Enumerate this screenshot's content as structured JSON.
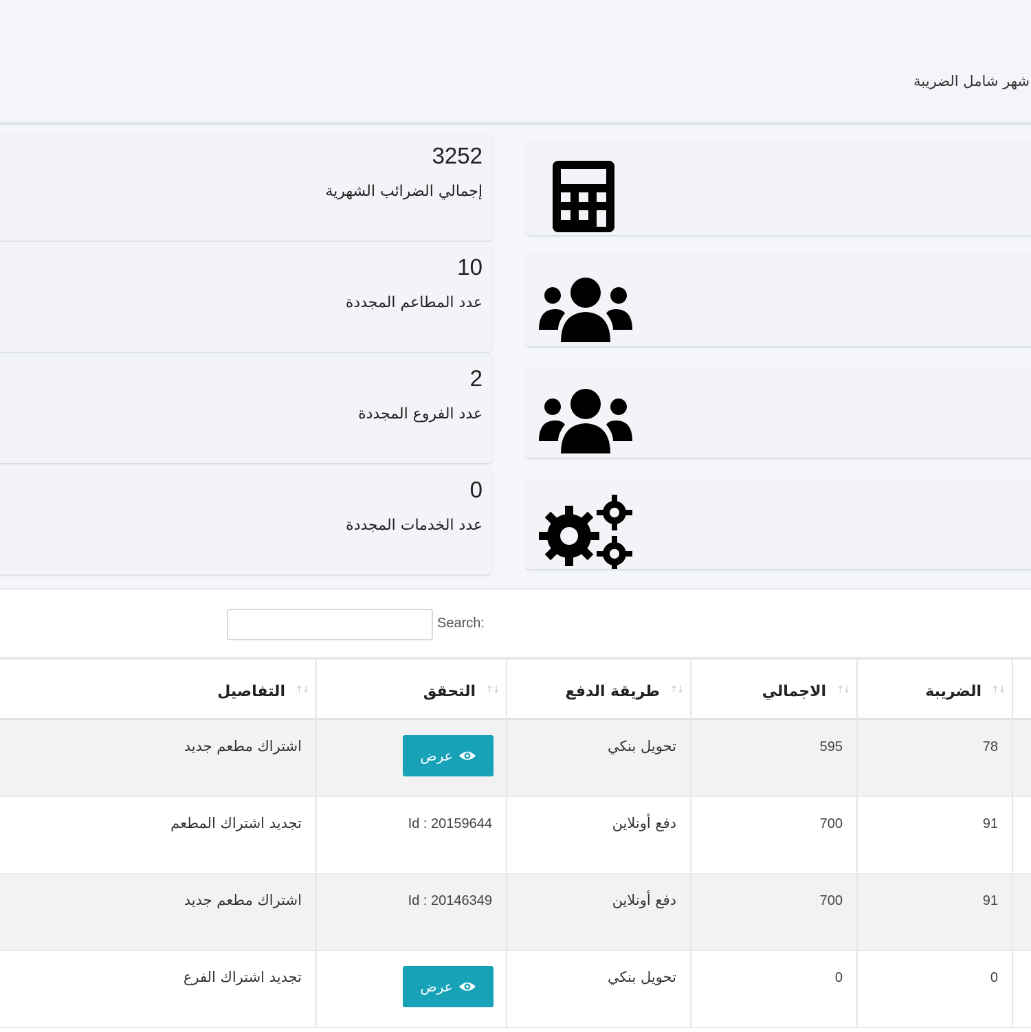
{
  "header": {
    "label": "شهر شامل الضريبة"
  },
  "stats": [
    {
      "value": "3252",
      "label": "إجمالي الضرائب الشهرية",
      "icon": "calculator-icon"
    },
    {
      "value": "10",
      "label": "عدد المطاعم المجددة",
      "icon": "users-icon"
    },
    {
      "value": "2",
      "label": "عدد الفروع المجددة",
      "icon": "users-icon"
    },
    {
      "value": "0",
      "label": "عدد الخدمات المجددة",
      "icon": "gears-icon"
    }
  ],
  "search": {
    "label": "Search:",
    "value": ""
  },
  "table": {
    "columns": [
      "الضريبة",
      "الاجمالي",
      "طريقة الدفع",
      "التحقق",
      "التفاصيل"
    ],
    "sort_icon": "sort-icon",
    "view_label": "عرض",
    "rows": [
      {
        "tax": "78",
        "total": "595",
        "payment": "تحويل بنكي",
        "verify": "",
        "verify_type": "button",
        "details": "اشتراك مطعم جديد"
      },
      {
        "tax": "91",
        "total": "700",
        "payment": "دفع أونلاين",
        "verify": "Id : 20159644",
        "verify_type": "text",
        "details": "تجديد اشتراك المطعم"
      },
      {
        "tax": "91",
        "total": "700",
        "payment": "دفع أونلاين",
        "verify": "Id : 20146349",
        "verify_type": "text",
        "details": "اشتراك مطعم جديد"
      },
      {
        "tax": "0",
        "total": "0",
        "payment": "تحويل بنكي",
        "verify": "",
        "verify_type": "button",
        "details": "تجديد اشتراك الفرع"
      }
    ]
  },
  "colors": {
    "accent": "#17a2b8",
    "background": "#f4f6f9",
    "striped_row": "#f2f2f2"
  }
}
